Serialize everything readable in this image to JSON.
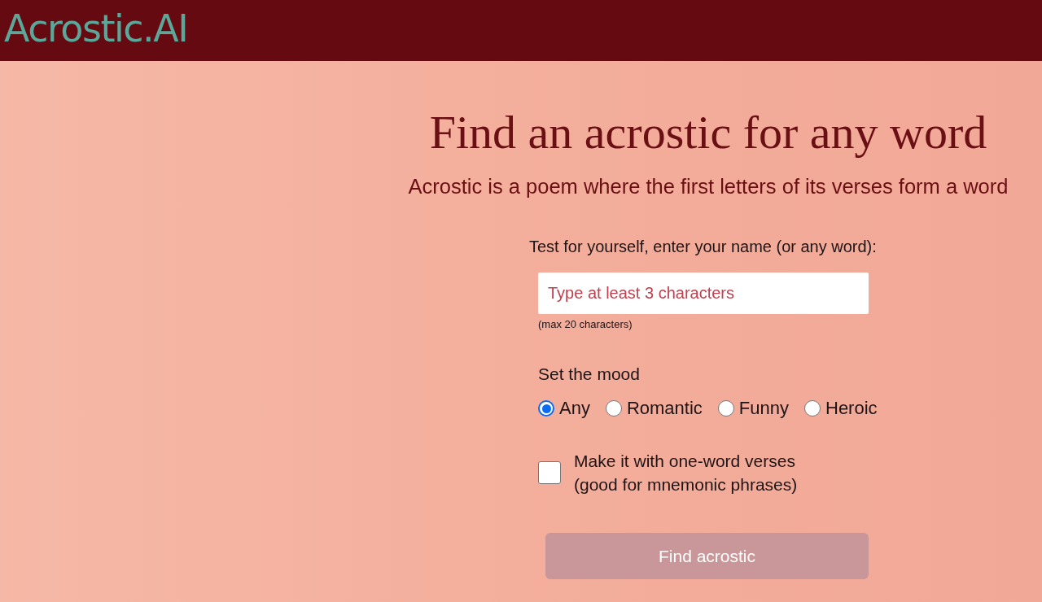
{
  "header": {
    "logo": "Acrostic.AI"
  },
  "hero": {
    "title": "Find an acrostic for any word",
    "subtitle": "Acrostic is a poem where the first letters of its verses form a word"
  },
  "form": {
    "word_label": "Test for yourself, enter your name (or any word):",
    "word_field": {
      "placeholder": "Type at least 3 characters",
      "hint": "(max 20 characters)"
    },
    "mood": {
      "label": "Set the mood",
      "options": [
        {
          "label": "Any",
          "selected": true
        },
        {
          "label": "Romantic",
          "selected": false
        },
        {
          "label": "Funny",
          "selected": false
        },
        {
          "label": "Heroic",
          "selected": false
        }
      ]
    },
    "one_word_option": {
      "label_lines": [
        "Make it with one-word verses",
        "(good for mnemonic phrases)"
      ],
      "checked": false
    },
    "submit": {
      "label": "Find acrostic",
      "disabled": true
    }
  }
}
